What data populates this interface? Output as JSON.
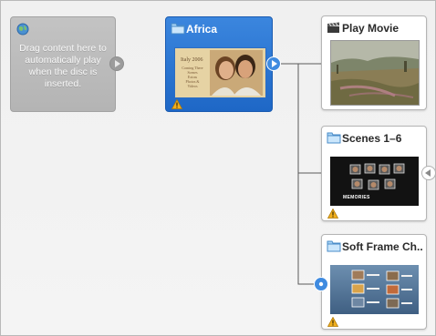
{
  "first_play": {
    "label": "Drag content here to automatically play when the disc is inserted."
  },
  "nodes": {
    "africa": {
      "title": "Africa",
      "thumb_date": "Italy 2006",
      "thumb_lines": [
        "Coming There",
        "Scenes",
        "Extras",
        "Photos & Videos"
      ]
    },
    "play_movie": {
      "title": "Play Movie"
    },
    "scenes": {
      "title": "Scenes 1–6",
      "thumb_label": "MEMORIES"
    },
    "soft_frame": {
      "title": "Soft Frame Ch..."
    }
  },
  "colors": {
    "selected_node": "#2a76d6",
    "first_play_bg": "#bcbcbc",
    "warning": "#f2b01e",
    "connector": "#5a5a5a"
  }
}
